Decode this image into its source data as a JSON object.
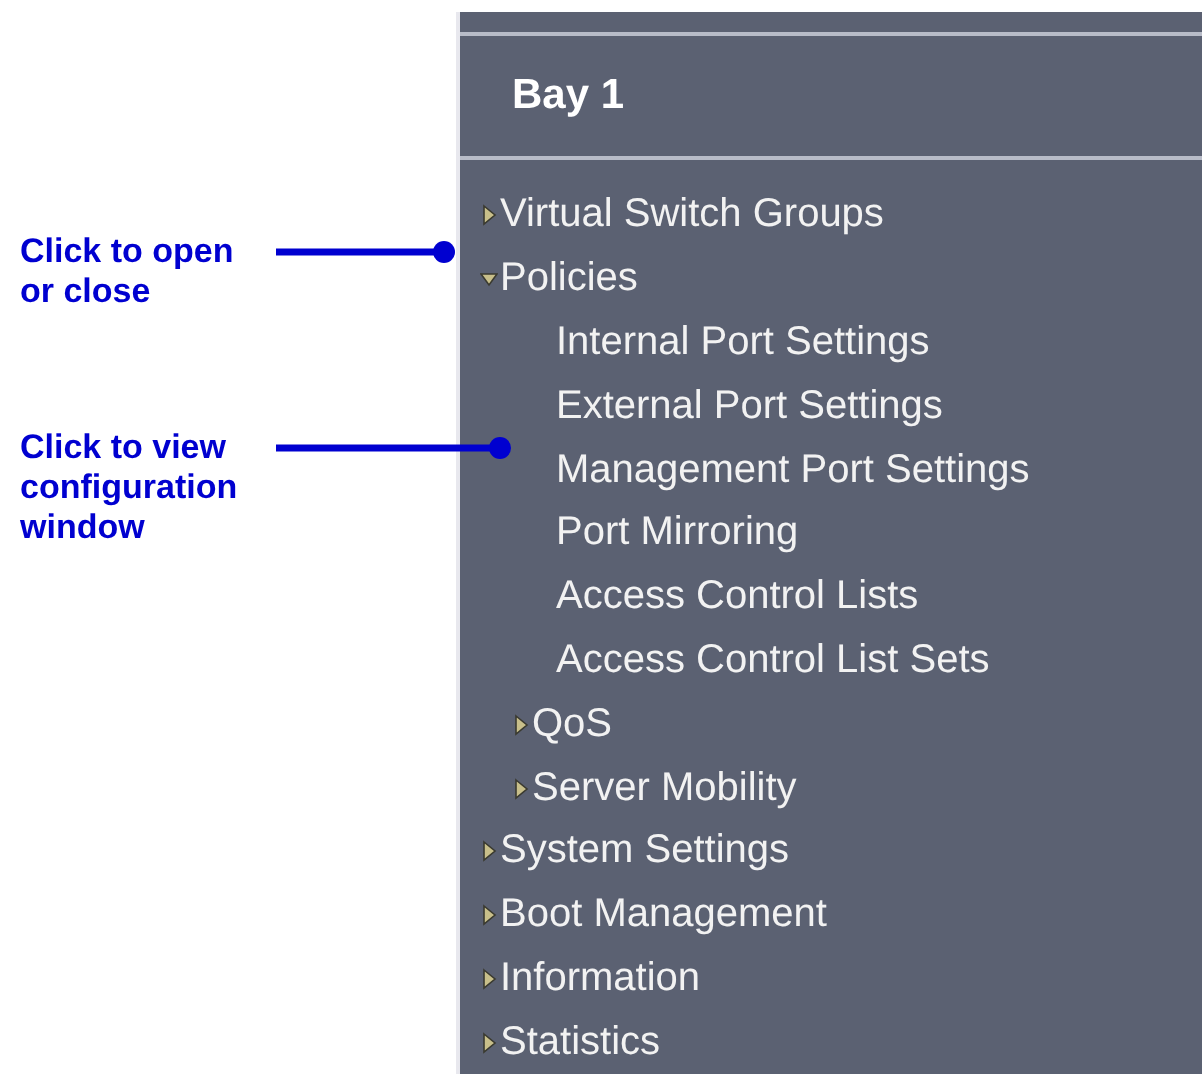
{
  "panel": {
    "title": "Bay 1"
  },
  "tree": [
    {
      "label": "Virtual Switch Groups",
      "kind": "folder",
      "expanded": false
    },
    {
      "label": "Policies",
      "kind": "folder",
      "expanded": true,
      "children": [
        {
          "label": "Internal Port Settings",
          "kind": "leaf"
        },
        {
          "label": "External Port Settings",
          "kind": "leaf"
        },
        {
          "label": "Management Port Settings",
          "kind": "leaf"
        },
        {
          "label": "Port Mirroring",
          "kind": "leaf"
        },
        {
          "label": "Access Control Lists",
          "kind": "leaf"
        },
        {
          "label": "Access Control List Sets",
          "kind": "leaf"
        },
        {
          "label": "QoS",
          "kind": "folder",
          "expanded": false
        },
        {
          "label": "Server Mobility",
          "kind": "folder",
          "expanded": false
        }
      ]
    },
    {
      "label": "System Settings",
      "kind": "folder",
      "expanded": false
    },
    {
      "label": "Boot Management",
      "kind": "folder",
      "expanded": false
    },
    {
      "label": "Information",
      "kind": "folder",
      "expanded": false
    },
    {
      "label": "Statistics",
      "kind": "folder",
      "expanded": false
    }
  ],
  "annotations": [
    {
      "text": "Click to open or close"
    },
    {
      "text": "Click to view configuration window"
    }
  ]
}
